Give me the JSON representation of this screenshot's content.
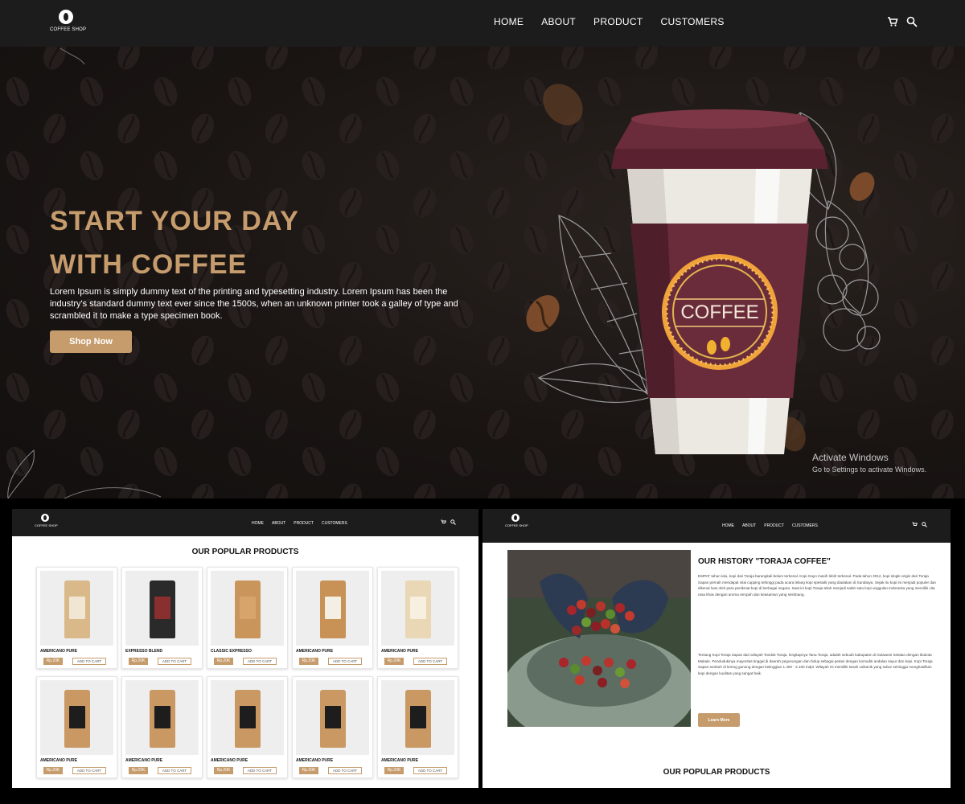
{
  "hero": {
    "brand": "COFFEE SHOP",
    "nav": [
      "HOME",
      "ABOUT",
      "PRODUCT",
      "CUSTOMERS"
    ],
    "title_line1": "START YOUR DAY",
    "title_line2": "WITH COFFEE",
    "description": "Lorem Ipsum is simply dummy text of the printing and typesetting industry. Lorem Ipsum has been the industry's standard dummy text ever since the 1500s, when an unknown printer took a galley of type and scrambled it to make a type specimen book.",
    "cta": "Shop Now",
    "cup_label": "COFFEE",
    "accent": "#c69c6d"
  },
  "windows_notice": {
    "title": "Activate Windows",
    "subtitle": "Go to Settings to activate Windows."
  },
  "products_panel": {
    "brand": "COFFEE SHOP",
    "nav": [
      "HOME",
      "ABOUT",
      "PRODUCT",
      "CUSTOMERS"
    ],
    "title": "OUR POPULAR PRODUCTS",
    "add_to_cart": "ADD TO CART",
    "products": [
      {
        "name": "AMERICANO PURE",
        "price": "Rp.20K",
        "bag_color": "#d9b98a",
        "label_color": "#f1e6d3"
      },
      {
        "name": "EXPRESSO BLEND",
        "price": "Rp.20K",
        "bag_color": "#2a2a2a",
        "label_color": "#8a2f2f"
      },
      {
        "name": "CLASSIC EXPRESSO",
        "price": "Rp.20K",
        "bag_color": "#c9955b",
        "label_color": "#d7a56c"
      },
      {
        "name": "AMERICANO PURE",
        "price": "Rp.20K",
        "bag_color": "#c89257",
        "label_color": "#f4efe5"
      },
      {
        "name": "AMERICANO PURE",
        "price": "Rp.20K",
        "bag_color": "#ead7b5",
        "label_color": "#f7efe0"
      },
      {
        "name": "AMERICANO PURE",
        "price": "Rp.20K",
        "bag_color": "#c99863",
        "label_color": "#1d1d1d"
      },
      {
        "name": "AMERICANO PURE",
        "price": "Rp.20K",
        "bag_color": "#c99863",
        "label_color": "#1d1d1d"
      },
      {
        "name": "AMERICANO PURE",
        "price": "Rp.20K",
        "bag_color": "#c99863",
        "label_color": "#1d1d1d"
      },
      {
        "name": "AMERICANO PURE",
        "price": "Rp.20K",
        "bag_color": "#c99863",
        "label_color": "#1d1d1d"
      },
      {
        "name": "AMERICANO PURE",
        "price": "Rp.20K",
        "bag_color": "#c99863",
        "label_color": "#1d1d1d"
      }
    ]
  },
  "history_panel": {
    "brand": "COFFEE SHOP",
    "nav": [
      "HOME",
      "ABOUT",
      "PRODUCT",
      "CUSTOMERS"
    ],
    "title": "OUR HISTORY \"TORAJA COFFEE\"",
    "paragraph1": "EMPAT tahun lalu, kopi dari Toraja barangkali belum terkenal. Kopi Gayo masih lebih terkenal. Pada tahun 2012, kopi single origin dari Toraja Sapan pernah mendapat nilai cupping tertinggi pada acara lelang kopi spesialti yang diadakan di Surabaya. Sejak itu kopi ini menjadi populer dan dikenal luas oleh para penikmat kopi di berbagai negara. Saat ini kopi Toraja telah menjadi salah satu kopi unggulan Indonesia yang memiliki cita rasa khas dengan aroma rempah dan keasaman yang seimbang.",
    "paragraph2": "Tentang Kopi Toraja Sapan dari wilayah Tondok Toraja, lengkapnya Tana Toraja, adalah sebuah kabupaten di Sulawesi Selatan dengan ibukota Makale. Pendudukinya mayoritas tinggal di daerah pegunungan dan hidup sebagai petani dengan komoditi andalan sayur dan kopi. Kopi Toraja Sapan tumbuh di lereng gunung dengan ketinggian 1.400 - 2.100 mdpl. Wilayah ini memiliki tanah vulkanik yang subur sehingga menghasilkan kopi dengan kualitas yang sangat baik.",
    "cta": "Learn More",
    "popular_title": "OUR POPULAR PRODUCTS"
  }
}
